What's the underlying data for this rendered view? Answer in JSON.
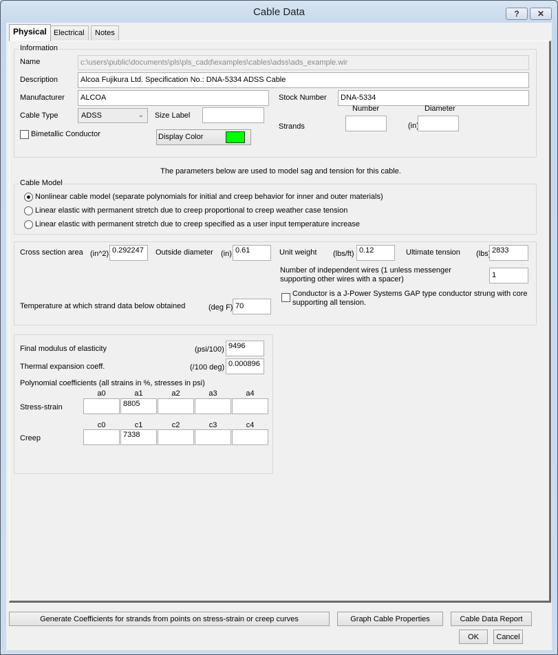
{
  "window": {
    "title": "Cable Data",
    "help_button": "?",
    "close_button": "✕"
  },
  "tabs": [
    {
      "label": "Physical",
      "active": true
    },
    {
      "label": "Electrical",
      "active": false
    },
    {
      "label": "Notes",
      "active": false
    }
  ],
  "information": {
    "group_label": "Information",
    "name_label": "Name",
    "name_value": "c:\\users\\public\\documents\\pls\\pls_cadd\\examples\\cables\\adss\\ads_example.wir",
    "description_label": "Description",
    "description_value": "Alcoa Fujikura Ltd. Specification No.: DNA-5334 ADSS Cable",
    "manufacturer_label": "Manufacturer",
    "manufacturer_value": "ALCOA",
    "stock_number_label": "Stock Number",
    "stock_number_value": "DNA-5334",
    "cable_type_label": "Cable Type",
    "cable_type_value": "ADSS",
    "size_label_label": "Size Label",
    "size_label_value": "",
    "strands_label": "Strands",
    "strands_number_header": "Number",
    "strands_diameter_header": "Diameter",
    "strands_diameter_unit": "(in)",
    "strands_number_value": "",
    "strands_diameter_value": "",
    "bimetallic_label": "Bimetallic Conductor",
    "bimetallic_checked": false,
    "display_color_label": "Display Color",
    "display_color": "#00ff00"
  },
  "model_note": "The parameters below are used to model sag and tension for this cable.",
  "cable_model": {
    "group_label": "Cable Model",
    "options": [
      {
        "label": "Nonlinear cable model (separate polynomials for initial and creep behavior for inner and outer materials)",
        "selected": true
      },
      {
        "label": "Linear elastic with permanent stretch due to creep proportional to creep weather case tension",
        "selected": false
      },
      {
        "label": "Linear elastic with permanent stretch due to creep specified as a user input temperature increase",
        "selected": false
      }
    ]
  },
  "properties": {
    "cross_section_label": "Cross section area",
    "cross_section_unit": "(in^2)",
    "cross_section_value": "0.292247",
    "outside_diameter_label": "Outside diameter",
    "outside_diameter_unit": "(in)",
    "outside_diameter_value": "0.61",
    "unit_weight_label": "Unit weight",
    "unit_weight_unit": "(lbs/ft)",
    "unit_weight_value": "0.12",
    "ultimate_tension_label": "Ultimate tension",
    "ultimate_tension_unit": "(lbs)",
    "ultimate_tension_value": "2833",
    "independent_wires_label_1": "Number of independent wires (1 unless messenger",
    "independent_wires_label_2": "supporting other wires with a spacer)",
    "independent_wires_value": "1",
    "gap_label_1": "Conductor is a J-Power Systems GAP type conductor strung with core",
    "gap_label_2": "supporting all tension.",
    "gap_checked": false,
    "temperature_label": "Temperature at which strand data below obtained",
    "temperature_unit": "(deg F)",
    "temperature_value": "70"
  },
  "strand": {
    "modulus_label": "Final modulus of elasticity",
    "modulus_unit": "(psi/100)",
    "modulus_value": "9496",
    "thermal_label": "Thermal expansion coeff.",
    "thermal_unit": "(/100 deg)",
    "thermal_value": "0.000896",
    "poly_label": "Polynomial coefficients (all strains in %, stresses in psi)",
    "stress_strain_label": "Stress-strain",
    "stress_headers": [
      "a0",
      "a1",
      "a2",
      "a3",
      "a4"
    ],
    "stress_values": [
      "",
      "8805",
      "",
      "",
      ""
    ],
    "creep_label": "Creep",
    "creep_headers": [
      "c0",
      "c1",
      "c2",
      "c3",
      "c4"
    ],
    "creep_values": [
      "",
      "7338",
      "",
      "",
      ""
    ]
  },
  "buttons": {
    "generate": "Generate Coefficients for strands from points on stress-strain or creep curves",
    "graph": "Graph Cable Properties",
    "report": "Cable Data Report",
    "ok": "OK",
    "cancel": "Cancel"
  }
}
